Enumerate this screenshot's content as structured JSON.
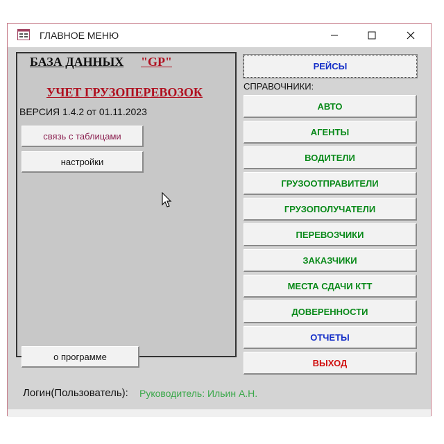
{
  "window": {
    "title": "ГЛАВНОЕ МЕНЮ"
  },
  "left": {
    "db_title": "БАЗА ДАННЫХ",
    "db_code": "\"GP\"",
    "app_title": "УЧЕТ ГРУЗОПЕРЕВОЗОК",
    "version": "ВЕРСИЯ 1.4.2 от 01.11.2023",
    "link_button": "связь с таблицами",
    "settings_button": "настройки",
    "about_button": "о программе"
  },
  "right": {
    "reisy": "РЕЙСЫ",
    "refs_label": "СПРАВОЧНИКИ:",
    "buttons": [
      "АВТО",
      "АГЕНТЫ",
      "ВОДИТЕЛИ",
      "ГРУЗООТПРАВИТЕЛИ",
      "ГРУЗОПОЛУЧАТЕЛИ",
      "ПЕРЕВОЗЧИКИ",
      "ЗАКАЗЧИКИ",
      "МЕСТА СДАЧИ КТТ",
      "ДОВЕРЕННОСТИ"
    ],
    "reports": "ОТЧЕТЫ",
    "exit": "ВЫХОД"
  },
  "login": {
    "label": "Логин(Пользователь):",
    "value": "Руководитель: Ильин А.Н."
  },
  "colors": {
    "green": "#0a8a1a",
    "blue": "#1630c8",
    "red": "#d01010",
    "accent_dark_red": "#b01020"
  }
}
